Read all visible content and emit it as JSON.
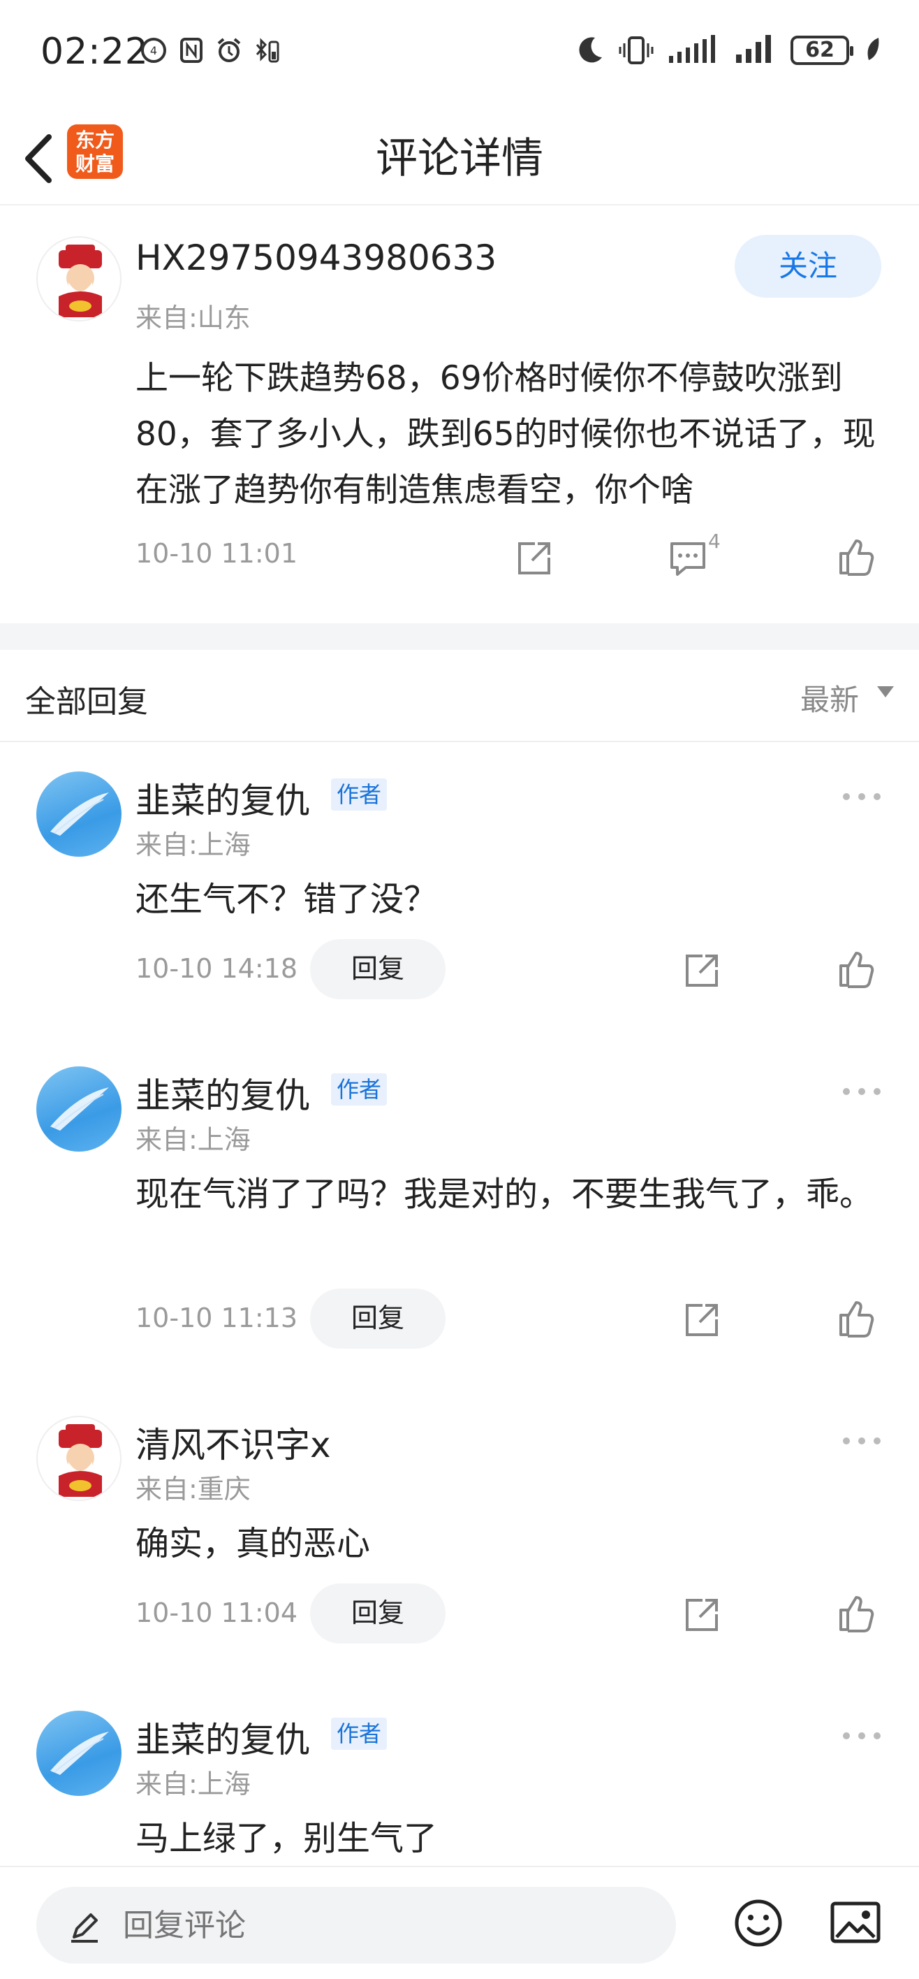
{
  "status": {
    "time": "02:22",
    "battery": "62"
  },
  "nav": {
    "title": "评论详情",
    "logo_line1": "东方",
    "logo_line2": "财富"
  },
  "original": {
    "username": "HX29750943980633",
    "location": "来自:山东",
    "follow_label": "关注",
    "text": "上一轮下跌趋势68，69价格时候你不停鼓吹涨到80，套了多小人，跌到65的时候你也不说话了，现在涨了趋势你有制造焦虑看空，你个啥",
    "time": "10-10 11:01",
    "comment_count": "4"
  },
  "replies_header": {
    "title": "全部回复",
    "sort": "最新"
  },
  "replies": [
    {
      "username": "韭菜的复仇",
      "badge": "作者",
      "location": "来自:上海",
      "text": "还生气不？错了没？",
      "time": "10-10 14:18",
      "reply_label": "回复",
      "avatar": "sky"
    },
    {
      "username": "韭菜的复仇",
      "badge": "作者",
      "location": "来自:上海",
      "text": "现在气消了了吗？我是对的，不要生我气了，乖。",
      "time": "10-10 11:13",
      "reply_label": "回复",
      "avatar": "sky"
    },
    {
      "username": "清风不识字x",
      "badge": "",
      "location": "来自:重庆",
      "text": "确实，真的恶心",
      "time": "10-10 11:04",
      "reply_label": "回复",
      "avatar": "god"
    },
    {
      "username": "韭菜的复仇",
      "badge": "作者",
      "location": "来自:上海",
      "text": "马上绿了，别生气了",
      "time": "",
      "reply_label": "",
      "avatar": "sky"
    }
  ],
  "bottom": {
    "placeholder": "回复评论"
  },
  "colors": {
    "accent": "#1877e6",
    "logo": "#f05a1a"
  }
}
